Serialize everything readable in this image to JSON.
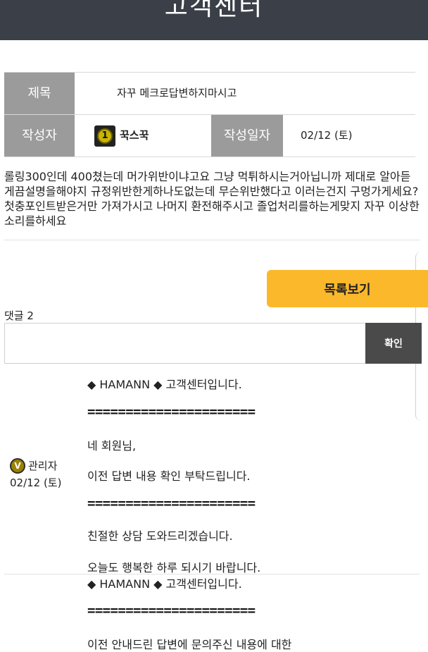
{
  "header": {
    "title": "고객센터"
  },
  "post": {
    "title_label": "제목",
    "title_value": "자꾸 메크로답변하지마시고",
    "author_label": "작성자",
    "author_level": "1",
    "author_name": "꾹스꾹",
    "date_label": "작성일자",
    "date_value": "02/12 (토)",
    "content": "롤링300인데 400쳤는데 머가위반이냐고요 그냥 먹튀하시는거아닙니까 제대로 알아듣게끔설명을해야지 규정위반한게하나도없는데 무슨위반했다고 이러는건지 구멍가게세요?첫충포인트받은거만 가져가시고 나머지 환전해주시고 졸업처리를하는게맞지 자꾸 이상한소리를하세요"
  },
  "buttons": {
    "list": "목록보기",
    "confirm": "확인"
  },
  "comments": {
    "count_label": "댓글 2",
    "first": {
      "badge": "V",
      "author": "관리자",
      "date": "02/12 (토)",
      "greeting": "◆ HAMANN ◆ 고객센터입니다.",
      "separator": "======================",
      "line1": "네 회원님,",
      "line2": "이전 답변 내용 확인 부탁드립니다.",
      "line3": "친절한 상담 도와드리겠습니다.",
      "line4": "오늘도 행복한 하루 되시기 바랍니다."
    },
    "second": {
      "greeting": "◆ HAMANN ◆ 고객센터입니다.",
      "separator": "======================",
      "line1": "이전 안내드린 답변에 문의주신 내용에 대한"
    }
  }
}
